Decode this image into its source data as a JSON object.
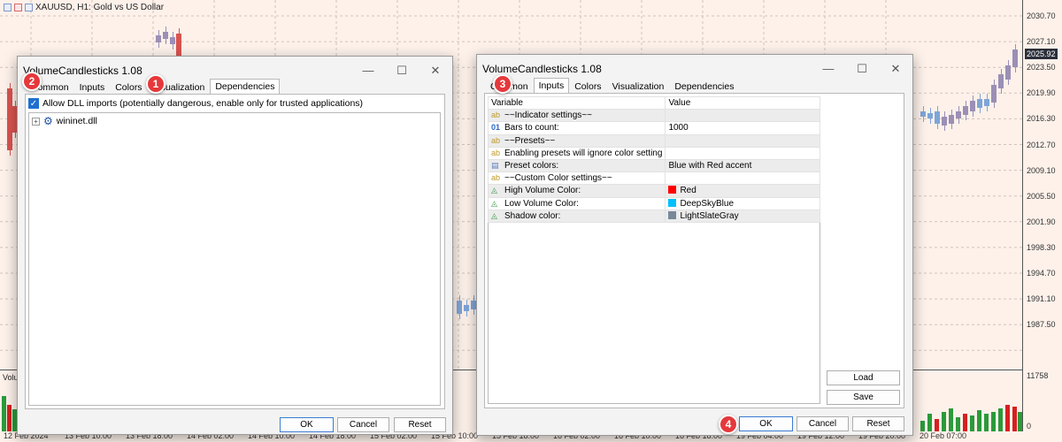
{
  "chart": {
    "title": "XAUUSD, H1:  Gold vs US Dollar",
    "volume_label": "Volu",
    "price_labels": [
      "2030.70",
      "2027.10",
      "2023.50",
      "2019.90",
      "2016.30",
      "2012.70",
      "2009.10",
      "2005.50",
      "2001.90",
      "1998.30",
      "1994.70",
      "1991.10",
      "1987.50"
    ],
    "current_price": "2025.92",
    "volume_axis_top": "11758",
    "volume_axis_bottom": "0",
    "time_labels": [
      "12 Feb 2024",
      "13 Feb 10:00",
      "13 Feb 18:00",
      "14 Feb 02:00",
      "14 Feb 10:00",
      "14 Feb 18:00",
      "15 Feb 02:00",
      "15 Feb 10:00",
      "15 Feb 18:00",
      "16 Feb 02:00",
      "16 Feb 10:00",
      "16 Feb 18:00",
      "19 Feb 04:00",
      "19 Feb 12:00",
      "19 Feb 20:00",
      "20 Feb 07:00"
    ]
  },
  "left_dialog": {
    "title": "VolumeCandlesticks 1.08",
    "tabs": [
      "Common",
      "Inputs",
      "Colors",
      "Visualization",
      "Dependencies"
    ],
    "active_tab": "Dependencies",
    "allow_dll_label": "Allow DLL imports (potentially dangerous, enable only for trusted applications)",
    "dll_name": "wininet.dll",
    "buttons": {
      "ok": "OK",
      "cancel": "Cancel",
      "reset": "Reset"
    }
  },
  "right_dialog": {
    "title": "VolumeCandlesticks 1.08",
    "tabs": [
      "Common",
      "Inputs",
      "Colors",
      "Visualization",
      "Dependencies"
    ],
    "active_tab": "Inputs",
    "table": {
      "header": {
        "variable": "Variable",
        "value": "Value"
      },
      "rows": [
        {
          "type": "ab",
          "variable": "~~Indicator settings~~",
          "value": ""
        },
        {
          "type": "01",
          "variable": "Bars to count:",
          "value": "1000"
        },
        {
          "type": "ab",
          "variable": "~~Presets~~",
          "value": ""
        },
        {
          "type": "ab",
          "variable": "Enabling presets will ignore color setting",
          "value": ""
        },
        {
          "type": "list",
          "variable": "Preset colors:",
          "value": "Blue with Red accent"
        },
        {
          "type": "ab",
          "variable": "~~Custom Color settings~~",
          "value": ""
        },
        {
          "type": "color",
          "variable": "High Volume Color:",
          "value": "Red",
          "color": "#ff0000"
        },
        {
          "type": "color",
          "variable": "Low Volume Color:",
          "value": "DeepSkyBlue",
          "color": "#00bfff"
        },
        {
          "type": "color",
          "variable": "Shadow color:",
          "value": "LightSlateGray",
          "color": "#778899"
        }
      ]
    },
    "side_buttons": {
      "load": "Load",
      "save": "Save"
    },
    "buttons": {
      "ok": "OK",
      "cancel": "Cancel",
      "reset": "Reset"
    }
  },
  "badges": [
    "1",
    "2",
    "3",
    "4"
  ]
}
